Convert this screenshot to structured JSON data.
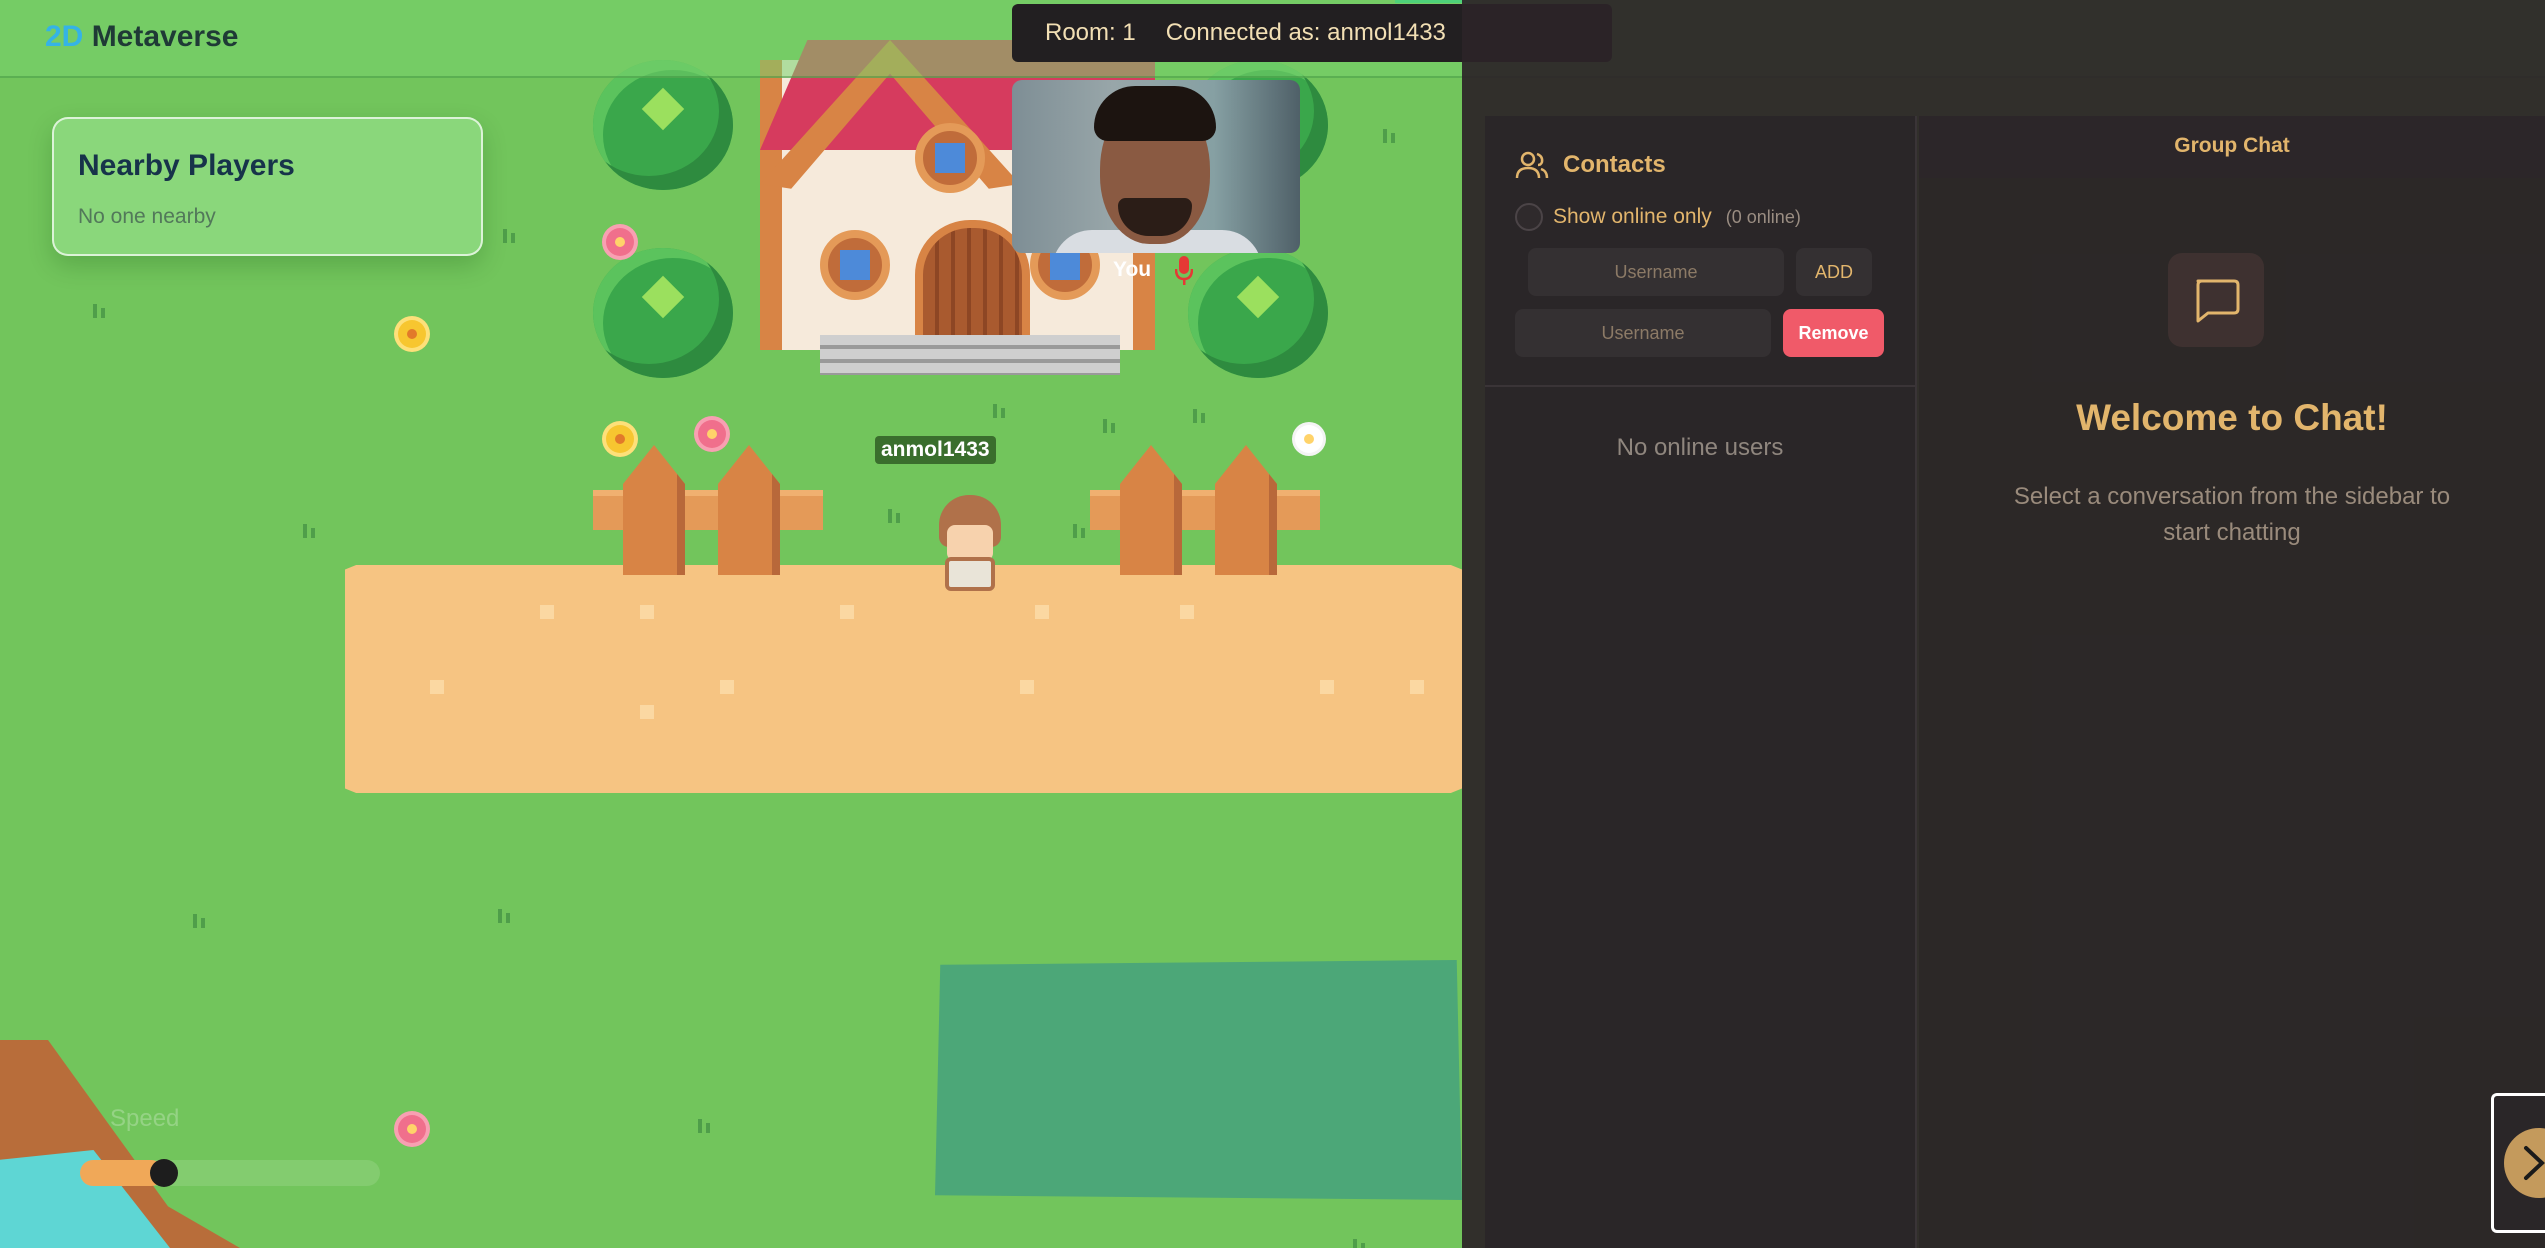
{
  "app": {
    "brand_prefix": "2D",
    "brand_suffix": " Metaverse"
  },
  "room_bar": {
    "room": "Room: 1",
    "connected": "Connected as: anmol1433"
  },
  "nearby_players": {
    "title": "Nearby Players",
    "empty": "No one nearby"
  },
  "video": {
    "label": "You",
    "mic_icon": "microphone-icon",
    "mic_color": "#e53935"
  },
  "player": {
    "name": "anmol1433"
  },
  "speed": {
    "label": "Speed",
    "value": 0.28
  },
  "contacts": {
    "title": "Contacts",
    "icon": "users-icon",
    "online_label": "Show online only",
    "online_count": "(0 online)",
    "add_placeholder": "Username",
    "add_label": "ADD",
    "remove_placeholder": "Username",
    "remove_label": "Remove",
    "empty": "No online users"
  },
  "chat": {
    "title": "Group Chat",
    "icon": "message-square-icon",
    "welcome_title": "Welcome to Chat!",
    "welcome_sub": "Select a conversation from the sidebar to start chatting"
  },
  "colors": {
    "accent": "#e2b56c",
    "remove": "#f05a69",
    "grass": "#72c55c",
    "path": "#f6c482",
    "panel": "#2a2628"
  }
}
